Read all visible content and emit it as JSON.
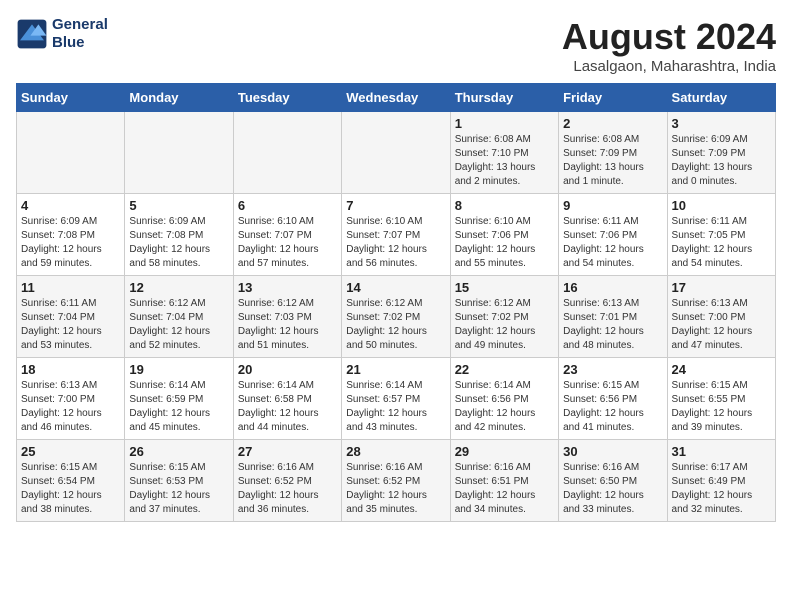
{
  "header": {
    "logo_line1": "General",
    "logo_line2": "Blue",
    "month_title": "August 2024",
    "location": "Lasalgaon, Maharashtra, India"
  },
  "days_of_week": [
    "Sunday",
    "Monday",
    "Tuesday",
    "Wednesday",
    "Thursday",
    "Friday",
    "Saturday"
  ],
  "weeks": [
    [
      {
        "day": "",
        "info": ""
      },
      {
        "day": "",
        "info": ""
      },
      {
        "day": "",
        "info": ""
      },
      {
        "day": "",
        "info": ""
      },
      {
        "day": "1",
        "info": "Sunrise: 6:08 AM\nSunset: 7:10 PM\nDaylight: 13 hours\nand 2 minutes."
      },
      {
        "day": "2",
        "info": "Sunrise: 6:08 AM\nSunset: 7:09 PM\nDaylight: 13 hours\nand 1 minute."
      },
      {
        "day": "3",
        "info": "Sunrise: 6:09 AM\nSunset: 7:09 PM\nDaylight: 13 hours\nand 0 minutes."
      }
    ],
    [
      {
        "day": "4",
        "info": "Sunrise: 6:09 AM\nSunset: 7:08 PM\nDaylight: 12 hours\nand 59 minutes."
      },
      {
        "day": "5",
        "info": "Sunrise: 6:09 AM\nSunset: 7:08 PM\nDaylight: 12 hours\nand 58 minutes."
      },
      {
        "day": "6",
        "info": "Sunrise: 6:10 AM\nSunset: 7:07 PM\nDaylight: 12 hours\nand 57 minutes."
      },
      {
        "day": "7",
        "info": "Sunrise: 6:10 AM\nSunset: 7:07 PM\nDaylight: 12 hours\nand 56 minutes."
      },
      {
        "day": "8",
        "info": "Sunrise: 6:10 AM\nSunset: 7:06 PM\nDaylight: 12 hours\nand 55 minutes."
      },
      {
        "day": "9",
        "info": "Sunrise: 6:11 AM\nSunset: 7:06 PM\nDaylight: 12 hours\nand 54 minutes."
      },
      {
        "day": "10",
        "info": "Sunrise: 6:11 AM\nSunset: 7:05 PM\nDaylight: 12 hours\nand 54 minutes."
      }
    ],
    [
      {
        "day": "11",
        "info": "Sunrise: 6:11 AM\nSunset: 7:04 PM\nDaylight: 12 hours\nand 53 minutes."
      },
      {
        "day": "12",
        "info": "Sunrise: 6:12 AM\nSunset: 7:04 PM\nDaylight: 12 hours\nand 52 minutes."
      },
      {
        "day": "13",
        "info": "Sunrise: 6:12 AM\nSunset: 7:03 PM\nDaylight: 12 hours\nand 51 minutes."
      },
      {
        "day": "14",
        "info": "Sunrise: 6:12 AM\nSunset: 7:02 PM\nDaylight: 12 hours\nand 50 minutes."
      },
      {
        "day": "15",
        "info": "Sunrise: 6:12 AM\nSunset: 7:02 PM\nDaylight: 12 hours\nand 49 minutes."
      },
      {
        "day": "16",
        "info": "Sunrise: 6:13 AM\nSunset: 7:01 PM\nDaylight: 12 hours\nand 48 minutes."
      },
      {
        "day": "17",
        "info": "Sunrise: 6:13 AM\nSunset: 7:00 PM\nDaylight: 12 hours\nand 47 minutes."
      }
    ],
    [
      {
        "day": "18",
        "info": "Sunrise: 6:13 AM\nSunset: 7:00 PM\nDaylight: 12 hours\nand 46 minutes."
      },
      {
        "day": "19",
        "info": "Sunrise: 6:14 AM\nSunset: 6:59 PM\nDaylight: 12 hours\nand 45 minutes."
      },
      {
        "day": "20",
        "info": "Sunrise: 6:14 AM\nSunset: 6:58 PM\nDaylight: 12 hours\nand 44 minutes."
      },
      {
        "day": "21",
        "info": "Sunrise: 6:14 AM\nSunset: 6:57 PM\nDaylight: 12 hours\nand 43 minutes."
      },
      {
        "day": "22",
        "info": "Sunrise: 6:14 AM\nSunset: 6:56 PM\nDaylight: 12 hours\nand 42 minutes."
      },
      {
        "day": "23",
        "info": "Sunrise: 6:15 AM\nSunset: 6:56 PM\nDaylight: 12 hours\nand 41 minutes."
      },
      {
        "day": "24",
        "info": "Sunrise: 6:15 AM\nSunset: 6:55 PM\nDaylight: 12 hours\nand 39 minutes."
      }
    ],
    [
      {
        "day": "25",
        "info": "Sunrise: 6:15 AM\nSunset: 6:54 PM\nDaylight: 12 hours\nand 38 minutes."
      },
      {
        "day": "26",
        "info": "Sunrise: 6:15 AM\nSunset: 6:53 PM\nDaylight: 12 hours\nand 37 minutes."
      },
      {
        "day": "27",
        "info": "Sunrise: 6:16 AM\nSunset: 6:52 PM\nDaylight: 12 hours\nand 36 minutes."
      },
      {
        "day": "28",
        "info": "Sunrise: 6:16 AM\nSunset: 6:52 PM\nDaylight: 12 hours\nand 35 minutes."
      },
      {
        "day": "29",
        "info": "Sunrise: 6:16 AM\nSunset: 6:51 PM\nDaylight: 12 hours\nand 34 minutes."
      },
      {
        "day": "30",
        "info": "Sunrise: 6:16 AM\nSunset: 6:50 PM\nDaylight: 12 hours\nand 33 minutes."
      },
      {
        "day": "31",
        "info": "Sunrise: 6:17 AM\nSunset: 6:49 PM\nDaylight: 12 hours\nand 32 minutes."
      }
    ]
  ]
}
